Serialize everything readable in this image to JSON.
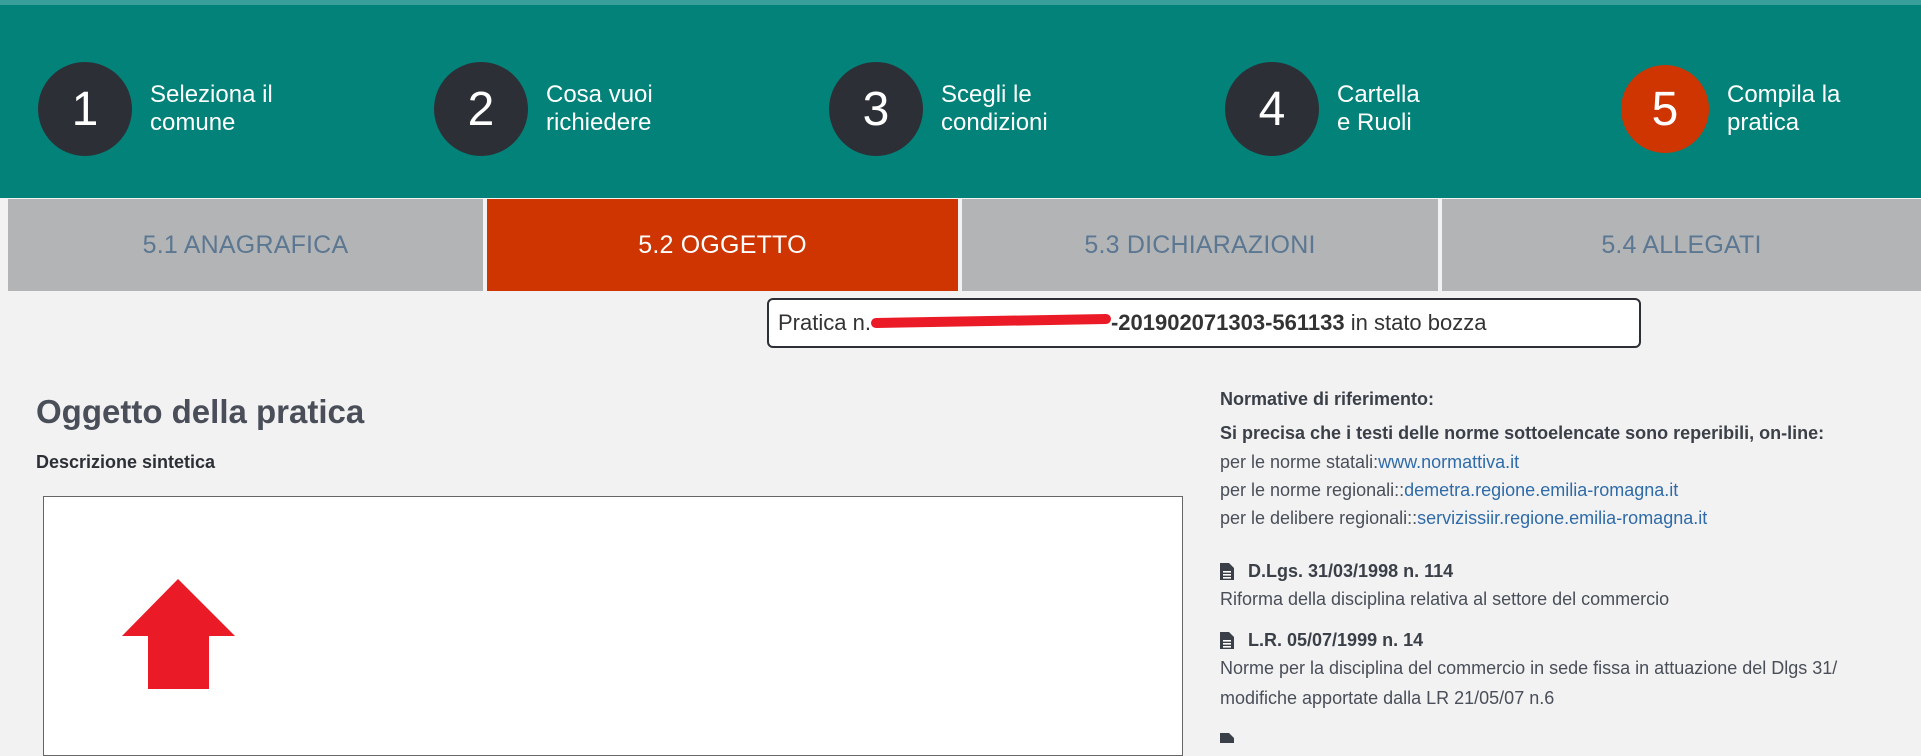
{
  "steps": [
    {
      "number": "1",
      "label_line1": "Seleziona il",
      "label_line2": "comune"
    },
    {
      "number": "2",
      "label_line1": "Cosa vuoi",
      "label_line2": "richiedere"
    },
    {
      "number": "3",
      "label_line1": "Scegli le",
      "label_line2": "condizioni"
    },
    {
      "number": "4",
      "label_line1": "Cartella",
      "label_line2": "e Ruoli"
    },
    {
      "number": "5",
      "label_line1": "Compila la",
      "label_line2": "pratica"
    }
  ],
  "active_step": "5",
  "subtabs": [
    {
      "label": "5.1 ANAGRAFICA"
    },
    {
      "label": "5.2 OGGETTO"
    },
    {
      "label": "5.3 DICHIARAZIONI"
    },
    {
      "label": "5.4 ALLEGATI"
    }
  ],
  "active_subtab": "5.2 OGGETTO",
  "status": {
    "prefix": "Pratica n.",
    "number_visible": "-201902071303-561133",
    "suffix": " in stato bozza"
  },
  "main": {
    "title": "Oggetto della pratica",
    "field_label": "Descrizione sintetica",
    "field_value": ""
  },
  "normative": {
    "heading": "Normative di riferimento:",
    "intro": "Si precisa che i testi delle norme sottoelencate sono reperibili, on-line:",
    "sources": [
      {
        "prefix": "per le norme statali:",
        "link": "www.normattiva.it"
      },
      {
        "prefix": "per le norme regionali::",
        "link": "demetra.regione.emilia-romagna.it"
      },
      {
        "prefix": "per le delibere regionali::",
        "link": "servizissiir.regione.emilia-romagna.it"
      }
    ],
    "laws": [
      {
        "title": "D.Lgs. 31/03/1998 n. 114",
        "desc_line1": "Riforma della disciplina relativa al settore del commercio",
        "desc_line2": ""
      },
      {
        "title": "L.R. 05/07/1999 n. 14",
        "desc_line1": "Norme per la disciplina del commercio in sede fissa in attuazione del Dlgs 31/",
        "desc_line2": "modifiche apportate dalla LR 21/05/07 n.6"
      }
    ]
  },
  "colors": {
    "header_bg": "#028279",
    "step_circle": "#2c3036",
    "active_accent": "#cf3500",
    "tab_bg": "#b3b4b6",
    "tab_text": "#5b7791",
    "link": "#2f6ba8",
    "arrow": "#ea1b26"
  },
  "icons": {
    "law_icon": "document-icon",
    "overlay_arrow": "up-arrow-icon"
  }
}
